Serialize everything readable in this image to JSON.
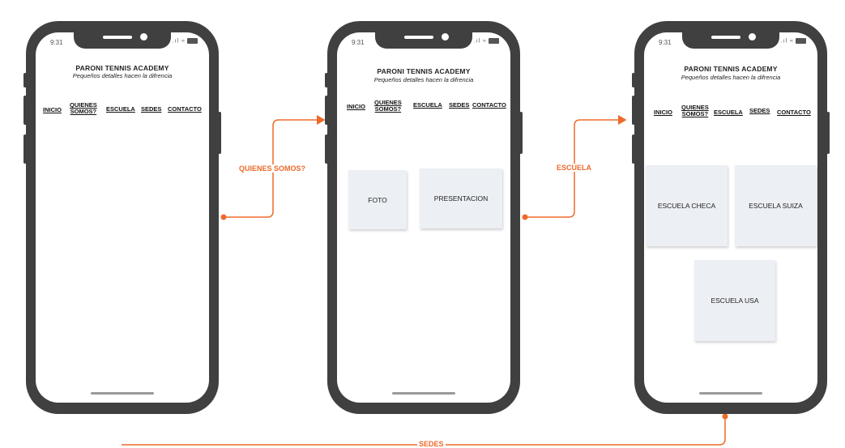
{
  "colors": {
    "connector": "#ee6a2a",
    "phone_body": "#404040",
    "card": "#eceff3"
  },
  "phones": [
    {
      "status": {
        "time": "9:31",
        "icons": [
          "signal-icon",
          "wifi-icon",
          "battery-icon"
        ]
      },
      "header": {
        "title": "PARONI TENNIS ACADEMY",
        "subtitle": "Pequeños detalles hacen la difrencia"
      },
      "nav": {
        "inicio": "INICIO",
        "quienes_1": "QUIENES",
        "quienes_2": "SOMOS?",
        "escuela": "ESCUELA",
        "sedes": "SEDES",
        "contacto": "CONTACTO"
      }
    },
    {
      "status": {
        "time": "9:31",
        "icons": [
          "signal-icon",
          "wifi-icon",
          "battery-icon"
        ]
      },
      "header": {
        "title": "PARONI TENNIS ACADEMY",
        "subtitle": "Pequeños detalles hacen la difrencia"
      },
      "nav": {
        "inicio": "INICIO",
        "quienes_1": "QUIENES",
        "quienes_2": "SOMOS?",
        "escuela": "ESCUELA",
        "sedes": "SEDES",
        "contacto": "CONTACTO"
      },
      "cards": {
        "foto": "FOTO",
        "presentacion": "PRESENTACION"
      }
    },
    {
      "status": {
        "time": "9:31",
        "icons": [
          "signal-icon",
          "wifi-icon",
          "battery-icon"
        ]
      },
      "header": {
        "title": "PARONI TENNIS ACADEMY",
        "subtitle": "Pequeños detalles hacen la difrencia"
      },
      "nav": {
        "inicio": "INICIO",
        "quienes_1": "QUIENES",
        "quienes_2": "SOMOS?",
        "escuela": "ESCUELA",
        "sedes": "SEDES",
        "contacto": "CONTACTO"
      },
      "cards": {
        "checa": "ESCUELA CHECA",
        "suiza": "ESCUELA SUIZA",
        "usa": "ESCUELA USA"
      }
    }
  ],
  "connectors": [
    {
      "label": "QUIENES SOMOS?",
      "from": "phone-1",
      "to": "phone-2"
    },
    {
      "label": "ESCUELA",
      "from": "phone-2",
      "to": "phone-3"
    },
    {
      "label": "SEDES",
      "from": "phone-3",
      "to": "offscreen"
    }
  ]
}
